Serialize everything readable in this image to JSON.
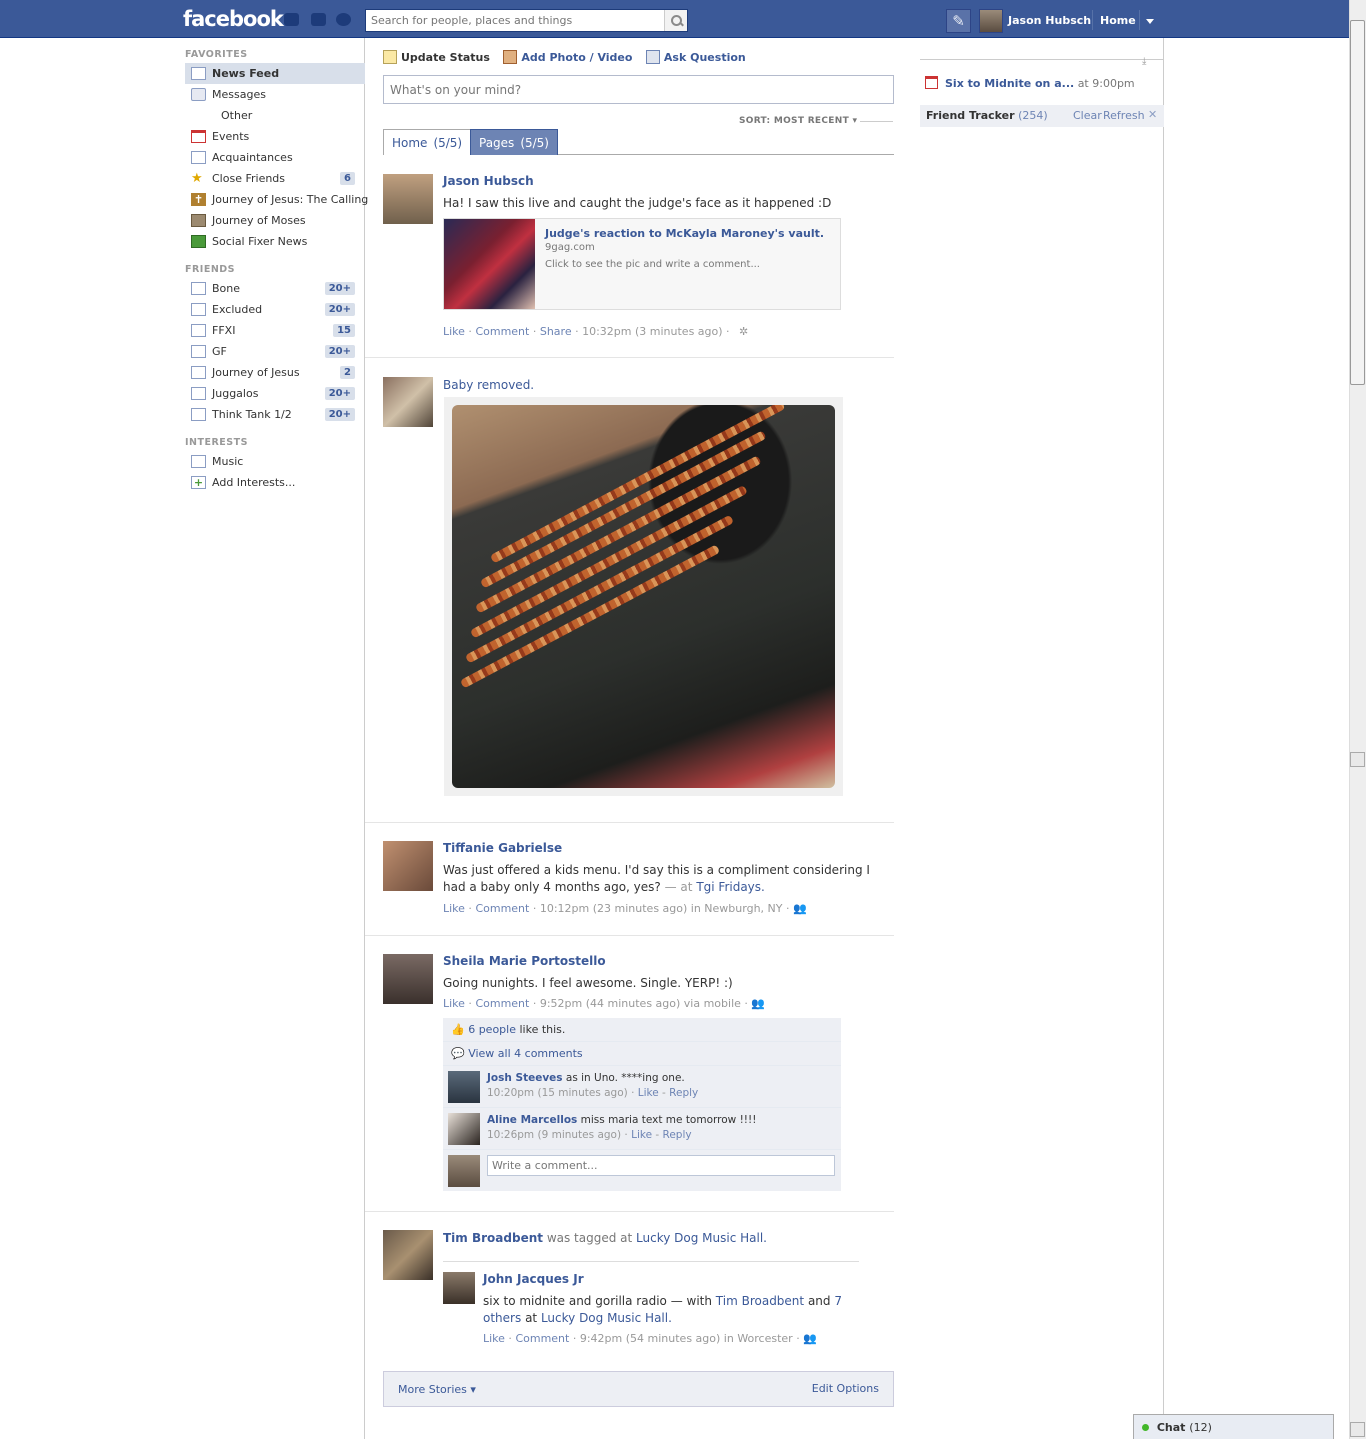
{
  "header": {
    "logo": "facebook",
    "search_placeholder": "Search for people, places and things",
    "user_name": "Jason Hubsch",
    "home_label": "Home",
    "brand_color": "#3b5998"
  },
  "sidebar": {
    "favorites_heading": "FAVORITES",
    "favorites": [
      {
        "label": "News Feed",
        "icon": "news-feed-icon",
        "count": ""
      },
      {
        "label": "Messages",
        "icon": "messages-icon",
        "count": ""
      },
      {
        "label": "Other",
        "icon": "",
        "count": ""
      },
      {
        "label": "Events",
        "icon": "events-calendar-icon",
        "count": ""
      },
      {
        "label": "Acquaintances",
        "icon": "list-icon",
        "count": ""
      },
      {
        "label": "Close Friends",
        "icon": "star-icon",
        "count": "6"
      },
      {
        "label": "Journey of Jesus: The Calling",
        "icon": "cross-icon",
        "count": ""
      },
      {
        "label": "Journey of Moses",
        "icon": "book-icon",
        "count": ""
      },
      {
        "label": "Social Fixer News",
        "icon": "rss-icon",
        "count": ""
      }
    ],
    "friends_heading": "FRIENDS",
    "friends": [
      {
        "label": "Bone",
        "count": "20+"
      },
      {
        "label": "Excluded",
        "count": "20+"
      },
      {
        "label": "FFXI",
        "count": "15"
      },
      {
        "label": "GF",
        "count": "20+"
      },
      {
        "label": "Journey of Jesus",
        "count": "2"
      },
      {
        "label": "Juggalos",
        "count": "20+"
      },
      {
        "label": "Think Tank 1/2",
        "count": "20+"
      }
    ],
    "interests_heading": "INTERESTS",
    "interests": [
      {
        "label": "Music",
        "icon": "list-icon"
      },
      {
        "label": "Add Interests...",
        "icon": "add-icon"
      }
    ]
  },
  "composer": {
    "update_status": "Update Status",
    "add_photo": "Add Photo / Video",
    "ask_question": "Ask Question",
    "placeholder": "What's on your mind?"
  },
  "feed": {
    "sort_label": "SORT: MOST RECENT",
    "tabs": [
      {
        "label": "Home",
        "count": "(5/5)"
      },
      {
        "label": "Pages",
        "count": "(5/5)"
      }
    ]
  },
  "stories": {
    "s1": {
      "author": "Jason Hubsch",
      "text": "Ha! I saw this live and caught the judge's face as it happened :D",
      "link_title": "Judge's reaction to McKayla Maroney's vault.",
      "link_domain": "9gag.com",
      "link_desc": "Click to see the pic and write a comment...",
      "like": "Like",
      "comment": "Comment",
      "share": "Share",
      "time": "10:32pm (3 minutes ago)"
    },
    "s2": {
      "caption": "Baby removed."
    },
    "s3": {
      "author": "Tiffanie Gabrielse",
      "text1": "Was just offered a kids menu. I'd say this is a compliment considering I",
      "text2": "had a baby only 4 months ago, yes?",
      "at_sep": "— at",
      "place": "Tgi Fridays.",
      "like": "Like",
      "comment": "Comment",
      "time": "10:12pm (23 minutes ago) in Newburgh, NY"
    },
    "s4": {
      "author": "Sheila Marie Portostello",
      "text": "Going nunights. I feel awesome. Single. YERP! :)",
      "like": "Like",
      "comment": "Comment",
      "time": "9:52pm (44 minutes ago) via mobile",
      "likes_people": "6 people",
      "likes_suffix": "like this.",
      "view_all": "View all 4 comments",
      "comments": [
        {
          "author": "Josh Steeves",
          "text": "as in Uno. ****ing one.",
          "time": "10:20pm (15 minutes ago)",
          "like": "Like",
          "reply": "Reply"
        },
        {
          "author": "Aline Marcellos",
          "text": "miss maria text me tomorrow !!!!",
          "time": "10:26pm (9 minutes ago)",
          "like": "Like",
          "reply": "Reply"
        }
      ],
      "write_comment": "Write a comment..."
    },
    "s5": {
      "author": "Tim Broadbent",
      "tagged_text": "was tagged at",
      "place": "Lucky Dog Music Hall.",
      "sub_author": "John Jacques Jr",
      "sub_text": "six to midnite and gorilla radio — with",
      "with_name": "Tim Broadbent",
      "and": "and",
      "others": "7",
      "others2": "others",
      "at": "at",
      "sub_place": "Lucky Dog Music Hall.",
      "like": "Like",
      "comment": "Comment",
      "time": "9:42pm (54 minutes ago) in Worcester"
    }
  },
  "footer": {
    "more_stories": "More Stories",
    "edit_options": "Edit Options"
  },
  "rightcol": {
    "event_title": "Six to Midnite on a...",
    "event_time": "at 9:00pm",
    "tracker_label": "Friend Tracker",
    "tracker_count": "(254)",
    "clear": "Clear",
    "refresh": "Refresh"
  },
  "chat": {
    "label": "Chat",
    "count": "(12)"
  }
}
